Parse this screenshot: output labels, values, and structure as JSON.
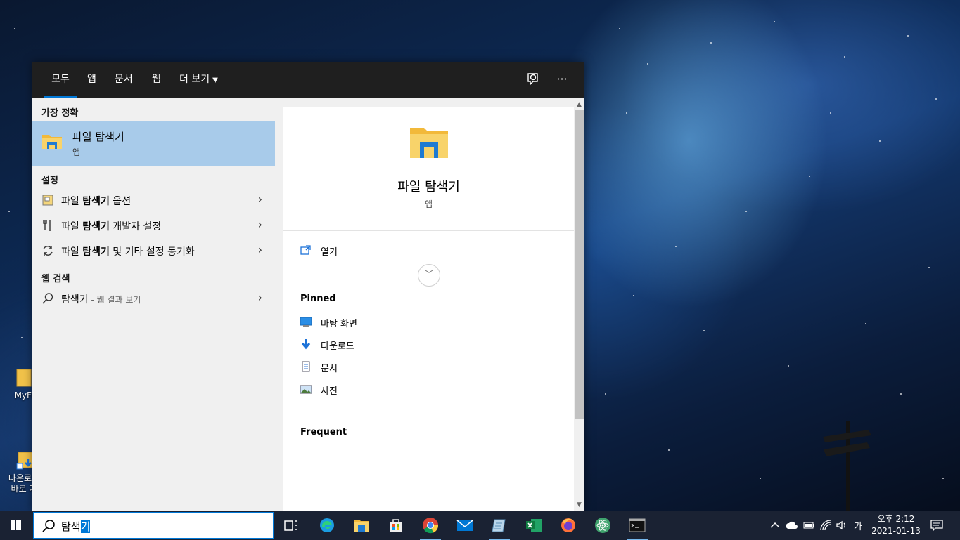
{
  "desktop": {
    "icons": [
      {
        "label": "MyFi"
      },
      {
        "label": "다운로드\n바로 가"
      }
    ]
  },
  "search_panel": {
    "tabs": [
      {
        "label": "모두",
        "active": true
      },
      {
        "label": "앱"
      },
      {
        "label": "문서"
      },
      {
        "label": "웹"
      },
      {
        "label": "더 보기"
      }
    ],
    "toolbar_icons": [
      "feedback-icon",
      "more-icon"
    ],
    "more_label": "···",
    "best_match": {
      "heading": "가장 정확",
      "title": "파일 탐색기",
      "subtitle": "앱"
    },
    "settings": {
      "heading": "설정",
      "items": [
        {
          "prefix": "파일 ",
          "bold": "탐색기",
          "suffix": " 옵션"
        },
        {
          "prefix": "파일 ",
          "bold": "탐색기",
          "suffix": " 개발자 설정"
        },
        {
          "prefix": "파일 ",
          "bold": "탐색기",
          "suffix": " 및 기타 설정 동기화"
        }
      ]
    },
    "web": {
      "heading": "웹 검색",
      "query": "탐색기",
      "hint": " - 웹 결과 보기"
    },
    "preview": {
      "title": "파일 탐색기",
      "subtitle": "앱",
      "open_label": "열기",
      "pinned_heading": "Pinned",
      "pinned": [
        {
          "label": "바탕 화면",
          "icon": "desktop-icon"
        },
        {
          "label": "다운로드",
          "icon": "download-icon"
        },
        {
          "label": "문서",
          "icon": "documents-icon"
        },
        {
          "label": "사진",
          "icon": "pictures-icon"
        }
      ],
      "frequent_heading": "Frequent"
    }
  },
  "taskbar": {
    "search_query_prefix": "탐색",
    "search_query_selected": "기",
    "apps": [
      "task-view",
      "edge",
      "file-explorer",
      "store",
      "chrome",
      "mail",
      "notepad",
      "excel",
      "firefox",
      "atom",
      "terminal"
    ],
    "tray": {
      "ime": "가",
      "time": "오후 2:12",
      "date": "2021-01-13"
    }
  },
  "colors": {
    "accent": "#0078d7",
    "best_match_bg": "#a8cbea",
    "panel_bg": "#f0f0f0",
    "topbar_bg": "#1f1f1f",
    "taskbar_bg": "#1a2233"
  }
}
